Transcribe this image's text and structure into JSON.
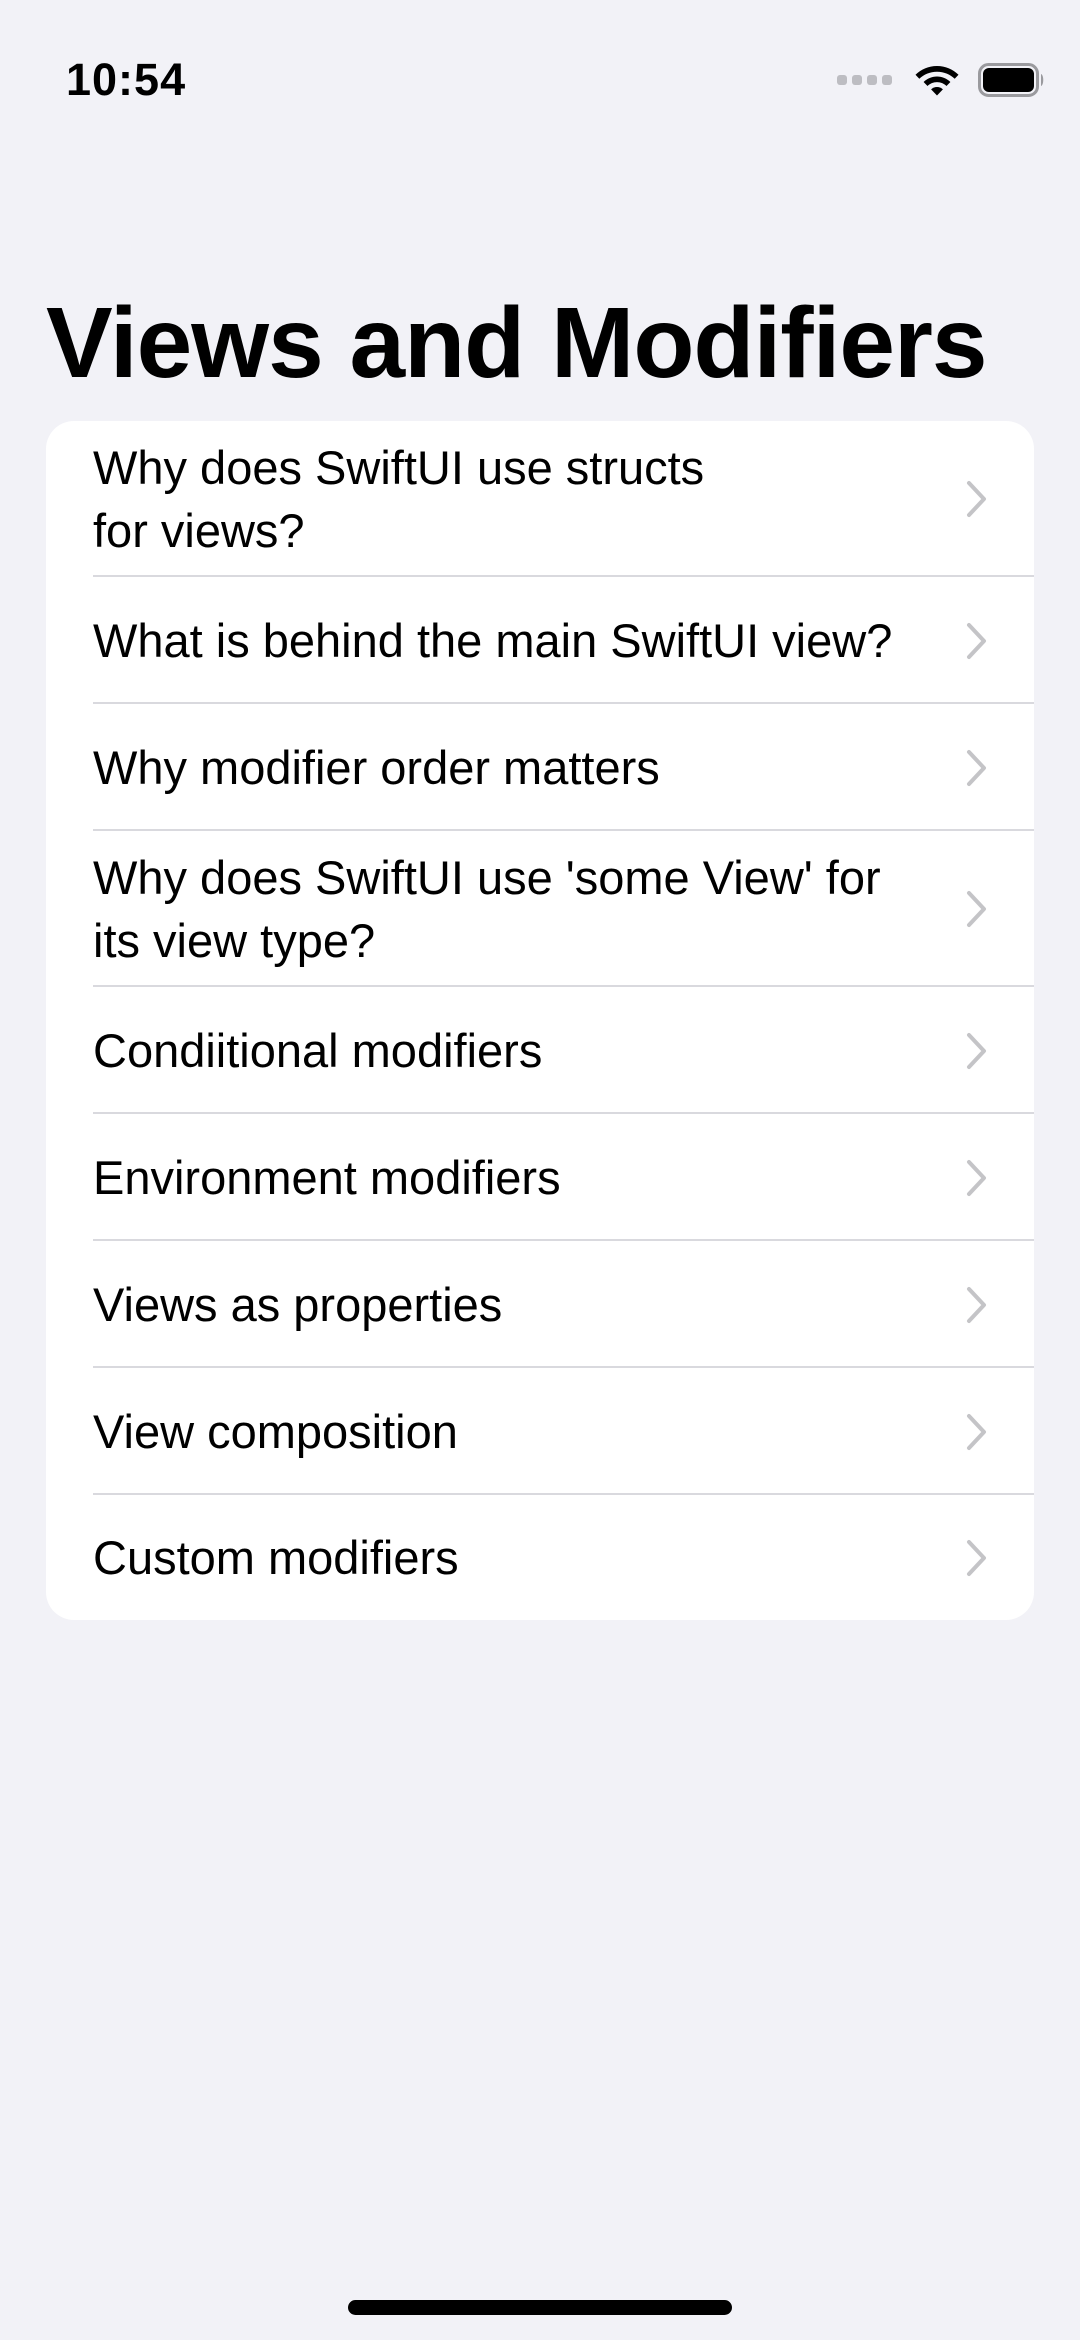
{
  "status_bar": {
    "time": "10:54",
    "icons": [
      "signal-dots-icon",
      "wifi-icon",
      "battery-icon"
    ]
  },
  "navigation": {
    "title": "Views and Modifiers"
  },
  "list": {
    "items": [
      {
        "label": "Why does SwiftUI use structs\nfor views?",
        "icon": "chevron-right-icon"
      },
      {
        "label": "What is behind the main SwiftUI view?",
        "icon": "chevron-right-icon"
      },
      {
        "label": "Why modifier order matters",
        "icon": "chevron-right-icon"
      },
      {
        "label": "Why does SwiftUI use 'some View' for\nits view type?",
        "icon": "chevron-right-icon"
      },
      {
        "label": "Condiitional modifiers",
        "icon": "chevron-right-icon"
      },
      {
        "label": "Environment modifiers",
        "icon": "chevron-right-icon"
      },
      {
        "label": "Views as properties",
        "icon": "chevron-right-icon"
      },
      {
        "label": "View composition",
        "icon": "chevron-right-icon"
      },
      {
        "label": "Custom modifiers",
        "icon": "chevron-right-icon"
      }
    ]
  },
  "colors": {
    "background": "#F2F2F7",
    "card": "#FFFFFF",
    "separator": "#D9D9DE",
    "chevron": "#C4C4C7",
    "text": "#000000"
  }
}
